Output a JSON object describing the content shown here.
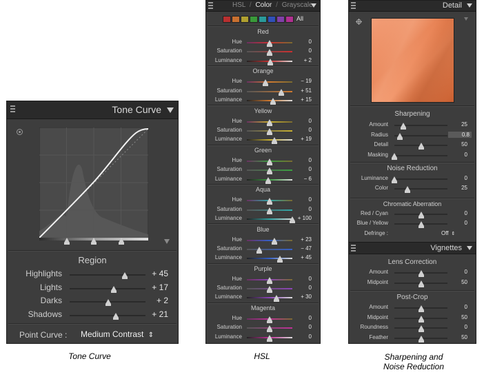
{
  "tone_curve": {
    "title": "Tone Curve",
    "region_title": "Region",
    "sliders": [
      {
        "label": "Highlights",
        "value": "+ 45",
        "pos": 0.725
      },
      {
        "label": "Lights",
        "value": "+ 17",
        "pos": 0.585
      },
      {
        "label": "Darks",
        "value": "+ 2",
        "pos": 0.51
      },
      {
        "label": "Shadows",
        "value": "+ 21",
        "pos": 0.605
      }
    ],
    "point_curve_label": "Point Curve :",
    "point_curve_value": "Medium Contrast",
    "point_curve_arrow": "⇕"
  },
  "hsl": {
    "tabs": [
      "HSL",
      "Color",
      "Grayscale"
    ],
    "separator": "/",
    "active_tab": "Color",
    "swatch_colors": [
      "#b83030",
      "#c87030",
      "#b0a030",
      "#3a9a3a",
      "#2a9a9a",
      "#3050b8",
      "#8040a8",
      "#b03090"
    ],
    "all_label": "All",
    "groups": [
      {
        "name": "Red",
        "color": "#cc3030",
        "rows": [
          {
            "label": "Hue",
            "value": "0",
            "pos": 0.5
          },
          {
            "label": "Saturation",
            "value": "0",
            "pos": 0.5
          },
          {
            "label": "Luminance",
            "value": "+ 2",
            "pos": 0.51
          }
        ]
      },
      {
        "name": "Orange",
        "color": "#d07a30",
        "rows": [
          {
            "label": "Hue",
            "value": "− 19",
            "pos": 0.41
          },
          {
            "label": "Saturation",
            "value": "+ 51",
            "pos": 0.75
          },
          {
            "label": "Luminance",
            "value": "+ 15",
            "pos": 0.58
          }
        ]
      },
      {
        "name": "Yellow",
        "color": "#c8b030",
        "rows": [
          {
            "label": "Hue",
            "value": "0",
            "pos": 0.5
          },
          {
            "label": "Saturation",
            "value": "0",
            "pos": 0.5
          },
          {
            "label": "Luminance",
            "value": "+ 19",
            "pos": 0.6
          }
        ]
      },
      {
        "name": "Green",
        "color": "#3aa040",
        "rows": [
          {
            "label": "Hue",
            "value": "0",
            "pos": 0.5
          },
          {
            "label": "Saturation",
            "value": "0",
            "pos": 0.5
          },
          {
            "label": "Luminance",
            "value": "− 6",
            "pos": 0.47
          }
        ]
      },
      {
        "name": "Aqua",
        "color": "#30a8a8",
        "rows": [
          {
            "label": "Hue",
            "value": "0",
            "pos": 0.5
          },
          {
            "label": "Saturation",
            "value": "0",
            "pos": 0.5
          },
          {
            "label": "Luminance",
            "value": "+ 100",
            "pos": 1.0
          }
        ]
      },
      {
        "name": "Blue",
        "color": "#3460c8",
        "rows": [
          {
            "label": "Hue",
            "value": "+ 23",
            "pos": 0.61
          },
          {
            "label": "Saturation",
            "value": "− 47",
            "pos": 0.27
          },
          {
            "label": "Luminance",
            "value": "+ 45",
            "pos": 0.72
          }
        ]
      },
      {
        "name": "Purple",
        "color": "#8c44b8",
        "rows": [
          {
            "label": "Hue",
            "value": "0",
            "pos": 0.5
          },
          {
            "label": "Saturation",
            "value": "0",
            "pos": 0.5
          },
          {
            "label": "Luminance",
            "value": "+ 30",
            "pos": 0.65
          }
        ]
      },
      {
        "name": "Magenta",
        "color": "#c03098",
        "rows": [
          {
            "label": "Hue",
            "value": "0",
            "pos": 0.5
          },
          {
            "label": "Saturation",
            "value": "0",
            "pos": 0.5
          },
          {
            "label": "Luminance",
            "value": "0",
            "pos": 0.5
          }
        ]
      }
    ]
  },
  "detail": {
    "title": "Detail",
    "sharpening": {
      "title": "Sharpening",
      "rows": [
        {
          "label": "Amount",
          "value": "25",
          "pos": 0.17
        },
        {
          "label": "Radius",
          "value": "0.8",
          "pos": 0.1,
          "highlight": true
        },
        {
          "label": "Detail",
          "value": "50",
          "pos": 0.5
        },
        {
          "label": "Masking",
          "value": "0",
          "pos": 0.0
        }
      ]
    },
    "noise": {
      "title": "Noise Reduction",
      "rows": [
        {
          "label": "Luminance",
          "value": "0",
          "pos": 0.0
        },
        {
          "label": "Color",
          "value": "25",
          "pos": 0.25
        }
      ]
    },
    "chromatic": {
      "title": "Chromatic Aberration",
      "rows": [
        {
          "label": "Red / Cyan",
          "value": "0",
          "pos": 0.5
        },
        {
          "label": "Blue / Yellow",
          "value": "0",
          "pos": 0.5
        }
      ],
      "defringe_label": "Defringe :",
      "defringe_value": "Off",
      "defringe_arrow": "⇕"
    },
    "vignettes_title": "Vignettes",
    "lens": {
      "title": "Lens Correction",
      "rows": [
        {
          "label": "Amount",
          "value": "0",
          "pos": 0.5
        },
        {
          "label": "Midpoint",
          "value": "50",
          "pos": 0.5
        }
      ]
    },
    "postcrop": {
      "title": "Post-Crop",
      "rows": [
        {
          "label": "Amount",
          "value": "0",
          "pos": 0.5
        },
        {
          "label": "Midpoint",
          "value": "50",
          "pos": 0.5
        },
        {
          "label": "Roundness",
          "value": "0",
          "pos": 0.5
        },
        {
          "label": "Feather",
          "value": "50",
          "pos": 0.5
        }
      ]
    }
  },
  "captions": {
    "tone_curve": "Tone Curve",
    "hsl": "HSL",
    "detail_line1": "Sharpening and",
    "detail_line2": "Noise Reduction"
  },
  "icons": [
    "panel-grip-icon",
    "collapse-triangle-icon",
    "target-adjust-icon",
    "crosshair-icon",
    "stepper-arrows-icon"
  ]
}
